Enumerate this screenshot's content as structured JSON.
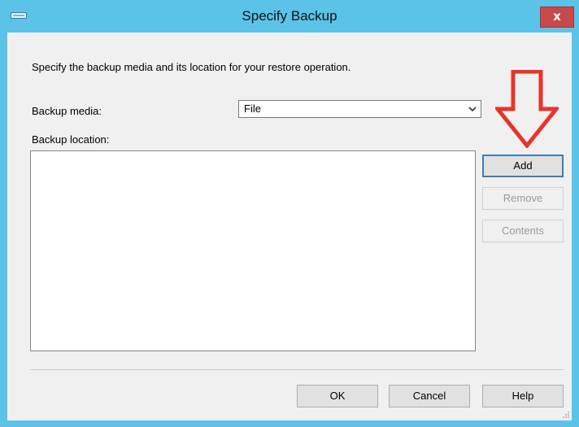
{
  "window": {
    "title": "Specify Backup",
    "close_label": "x"
  },
  "dialog": {
    "instruction": "Specify the backup media and its location for your restore operation.",
    "backup_media_label": "Backup media:",
    "backup_media_value": "File",
    "backup_location_label": "Backup location:",
    "backup_locations": []
  },
  "buttons": {
    "add": "Add",
    "remove": "Remove",
    "contents": "Contents",
    "ok": "OK",
    "cancel": "Cancel",
    "help": "Help"
  },
  "annotation": {
    "arrow_color": "#e8332a",
    "icon": "down-arrow-icon"
  },
  "colors": {
    "titlebar": "#5bc3e8",
    "close_button": "#c74a4a",
    "dialog_bg": "#f0f0f0"
  }
}
